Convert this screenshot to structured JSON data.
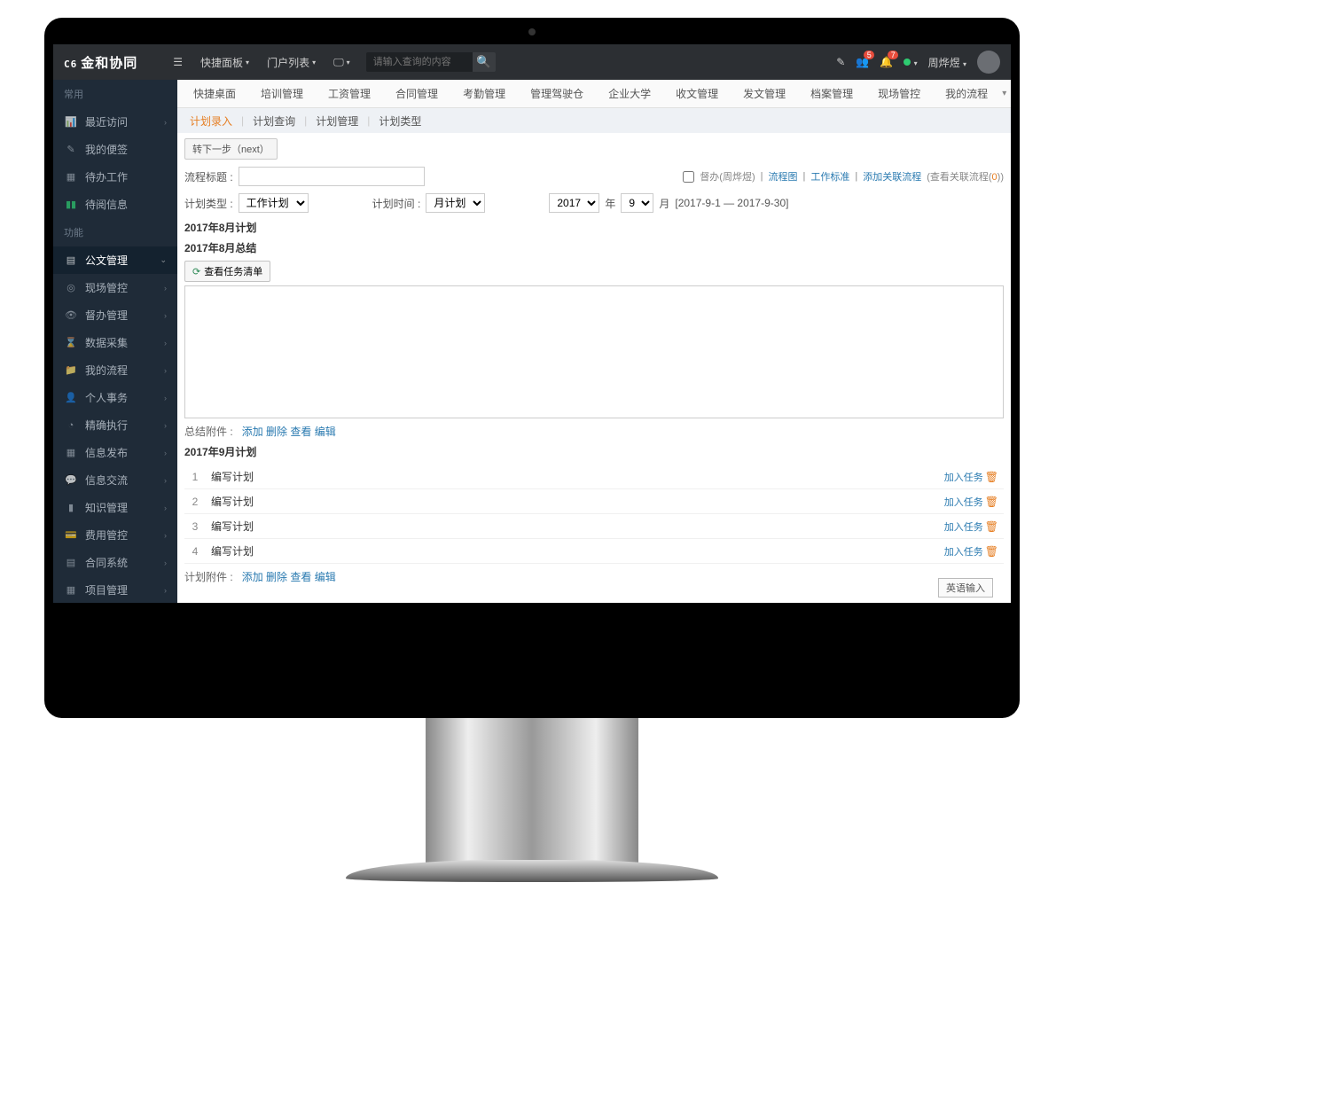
{
  "header": {
    "logo_prefix": "C6",
    "logo": "金和协同",
    "menu": [
      "快捷面板",
      "门户列表"
    ],
    "search_placeholder": "请输入查询的内容",
    "user": "周烨煜",
    "notif1": "5",
    "notif2": "7"
  },
  "sidebar": {
    "group1": "常用",
    "items1": [
      "最近访问",
      "我的便签",
      "待办工作",
      "待阅信息"
    ],
    "group2": "功能",
    "items2": [
      "公文管理",
      "现场管控",
      "督办管理",
      "数据采集",
      "我的流程",
      "个人事务",
      "精确执行",
      "信息发布",
      "信息交流",
      "知识管理",
      "费用管控",
      "合同系统",
      "项目管理"
    ]
  },
  "tabs1": [
    "快捷桌面",
    "培训管理",
    "工资管理",
    "合同管理",
    "考勤管理",
    "管理驾驶仓",
    "企业大学",
    "收文管理",
    "发文管理",
    "档案管理",
    "现场管控",
    "我的流程"
  ],
  "tabs2": [
    "计划录入",
    "计划查询",
    "计划管理",
    "计划类型"
  ],
  "form": {
    "next_btn": "转下一步（next）",
    "title_lbl": "流程标题 :",
    "type_lbl": "计划类型 :",
    "type_val": "工作计划",
    "time_lbl": "计划时间 :",
    "time_val": "月计划",
    "year": "2017",
    "year_unit": "年",
    "month": "9",
    "month_unit": "月",
    "range": "[2017-9-1 — 2017-9-30]",
    "suboffice": "督办(周烨煜)",
    "flowchart": "流程图",
    "standard": "工作标准",
    "addrel": "添加关联流程",
    "viewrel": "(查看关联流程(",
    "viewrel_count": "0",
    "viewrel_close": "))"
  },
  "sections": {
    "s1": "2017年8月计划",
    "s2": "2017年8月总结",
    "task_btn": "查看任务清单",
    "attach1_lbl": "总结附件 :",
    "s3": "2017年9月计划",
    "attach2_lbl": "计划附件 :",
    "ops": {
      "add": "添加",
      "del": "删除",
      "view": "查看",
      "edit": "编辑"
    }
  },
  "plans": [
    {
      "i": "1",
      "t": "编写计划"
    },
    {
      "i": "2",
      "t": "编写计划"
    },
    {
      "i": "3",
      "t": "编写计划"
    },
    {
      "i": "4",
      "t": "编写计划"
    }
  ],
  "add_task": "加入任务",
  "ime": "英语输入"
}
